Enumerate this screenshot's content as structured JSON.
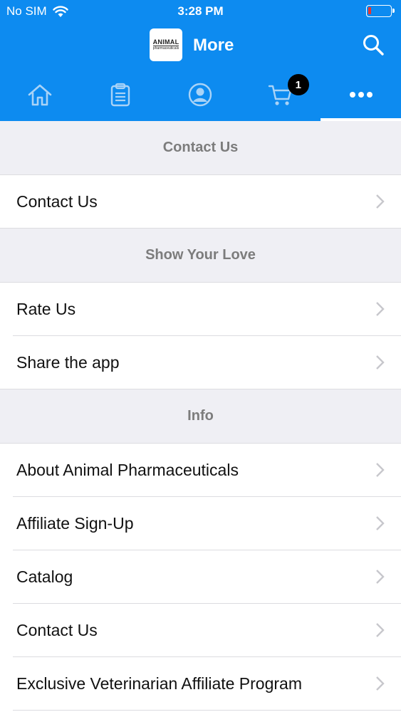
{
  "colors": {
    "brand": "#0d8bf0"
  },
  "status_bar": {
    "carrier": "No SIM",
    "time": "3:28 PM"
  },
  "nav": {
    "logo_line1": "ANIMAL",
    "logo_line2": "pharmaceuticals",
    "title": "More"
  },
  "tabs": [
    {
      "icon": "home-icon",
      "active": false
    },
    {
      "icon": "clipboard-icon",
      "active": false
    },
    {
      "icon": "account-icon",
      "active": false
    },
    {
      "icon": "cart-icon",
      "badge": "1",
      "active": false
    },
    {
      "icon": "more-icon",
      "active": true
    }
  ],
  "sections": [
    {
      "header": "Contact Us",
      "items": [
        {
          "label": "Contact Us"
        }
      ]
    },
    {
      "header": "Show Your Love",
      "items": [
        {
          "label": "Rate Us"
        },
        {
          "label": "Share the app"
        }
      ]
    },
    {
      "header": "Info",
      "items": [
        {
          "label": "About Animal Pharmaceuticals"
        },
        {
          "label": "Affiliate Sign-Up"
        },
        {
          "label": "Catalog"
        },
        {
          "label": "Contact Us"
        },
        {
          "label": "Exclusive Veterinarian Affiliate Program"
        }
      ]
    }
  ]
}
